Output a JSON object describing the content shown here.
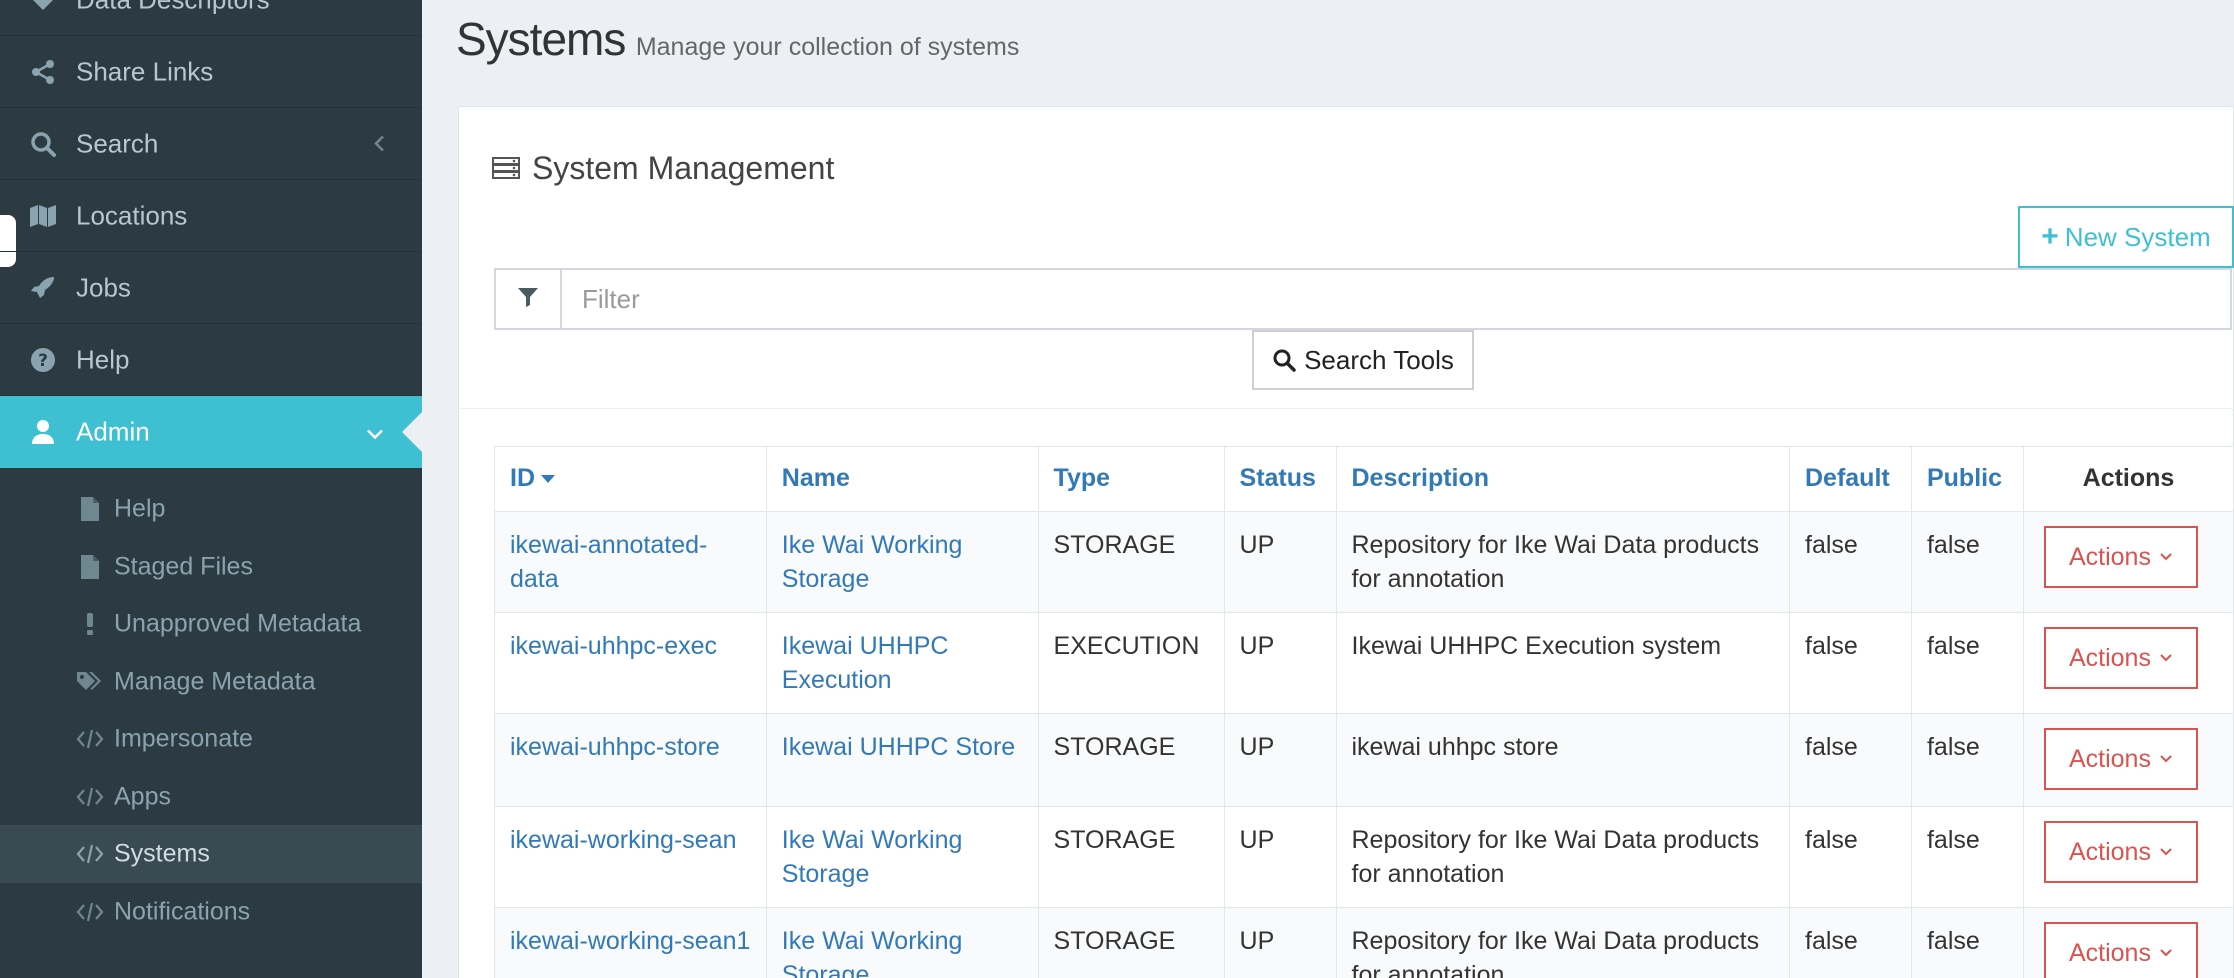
{
  "sidebar": {
    "items": [
      {
        "label": "Data Descriptors",
        "icon": "tag-icon"
      },
      {
        "label": "Share Links",
        "icon": "share-icon"
      },
      {
        "label": "Search",
        "icon": "search-icon"
      },
      {
        "label": "Locations",
        "icon": "map-icon"
      },
      {
        "label": "Jobs",
        "icon": "rocket-icon"
      },
      {
        "label": "Help",
        "icon": "question-circle-icon"
      },
      {
        "label": "Admin",
        "icon": "user-icon"
      }
    ],
    "admin_submenu": [
      {
        "label": "Help",
        "icon": "file-icon"
      },
      {
        "label": "Staged Files",
        "icon": "file-icon"
      },
      {
        "label": "Unapproved Metadata",
        "icon": "exclamation-icon"
      },
      {
        "label": "Manage Metadata",
        "icon": "tags-icon"
      },
      {
        "label": "Impersonate",
        "icon": "code-icon"
      },
      {
        "label": "Apps",
        "icon": "code-icon"
      },
      {
        "label": "Systems",
        "icon": "code-icon"
      },
      {
        "label": "Notifications",
        "icon": "code-icon"
      }
    ],
    "active_item": "Admin",
    "selected_subitem": "Systems"
  },
  "page": {
    "title": "Systems",
    "subtitle": "Manage your collection of systems"
  },
  "box": {
    "title": "System Management",
    "new_button": "New System",
    "filter_placeholder": "Filter",
    "search_tools_button": "Search Tools"
  },
  "table": {
    "headers": [
      "ID",
      "Name",
      "Type",
      "Status",
      "Description",
      "Default",
      "Public",
      "Actions"
    ],
    "rows": [
      {
        "id": "ikewai-annotated-data",
        "name": "Ike Wai Working Storage",
        "type": "STORAGE",
        "status": "UP",
        "description": "Repository for Ike Wai Data products for annotation",
        "default": "false",
        "public": "false",
        "action": "Actions"
      },
      {
        "id": "ikewai-uhhpc-exec",
        "name": "Ikewai UHHPC Execution",
        "type": "EXECUTION",
        "status": "UP",
        "description": "Ikewai UHHPC Execution system",
        "default": "false",
        "public": "false",
        "action": "Actions"
      },
      {
        "id": "ikewai-uhhpc-store",
        "name": "Ikewai UHHPC Store",
        "type": "STORAGE",
        "status": "UP",
        "description": "ikewai uhhpc store",
        "default": "false",
        "public": "false",
        "action": "Actions"
      },
      {
        "id": "ikewai-working-sean",
        "name": "Ike Wai Working Storage",
        "type": "STORAGE",
        "status": "UP",
        "description": "Repository for Ike Wai Data products for annotation",
        "default": "false",
        "public": "false",
        "action": "Actions"
      },
      {
        "id": "ikewai-working-sean1",
        "name": "Ike Wai Working Storage",
        "type": "STORAGE",
        "status": "UP",
        "description": "Repository for Ike Wai Data products for annotation",
        "default": "false",
        "public": "false",
        "action": "Actions"
      }
    ]
  },
  "colors": {
    "sidebar_bg": "#2c3b41",
    "active_accent": "#3fc0d2",
    "link": "#3279b7",
    "danger": "#d9534f"
  }
}
